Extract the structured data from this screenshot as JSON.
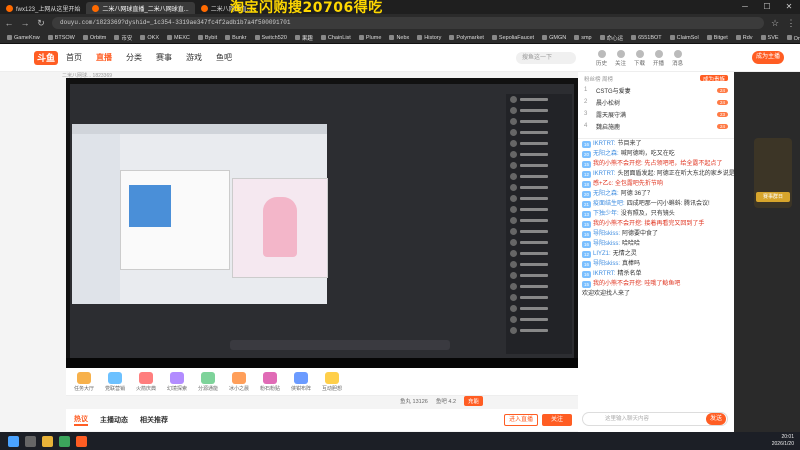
{
  "browser": {
    "tabs": [
      {
        "label": "fwx123_上网从这里开始",
        "active": false
      },
      {
        "label": "二米八网球直播_二米八网球直...",
        "active": true
      },
      {
        "label": "二米八网球直...",
        "active": false
      }
    ],
    "promo_banner": "淘宝闪购搜20706得吃",
    "url": "douyu.com/1823369?dyshid=_1c354-3319ae347fc4f2adb1b7a4f500091701",
    "bookmarks": [
      "GameKnw",
      "BTSOW",
      "Orbitm",
      "币安",
      "OKX",
      "MEXC",
      "Bybit",
      "Bunkr",
      "Switch520",
      "果趣",
      "ChainList",
      "Plume",
      "Nebx",
      "History",
      "Polymarket",
      "SepoliaFaucet",
      "GMGN",
      "smp",
      "命心运",
      "6551BOT",
      "ClaimSol",
      "Bitget",
      "Rdv",
      "SVE",
      "Onlve - 鑫鑫"
    ]
  },
  "site": {
    "logo": "斗鱼",
    "nav": [
      "首页",
      "直播",
      "分类",
      "赛事",
      "游戏",
      "鱼吧"
    ],
    "search_placeholder": "搜鱼这一下",
    "top_icons": [
      "历史",
      "关注",
      "下载",
      "开播",
      "消息"
    ],
    "login": "成为主播",
    "room_subtitle": "二米八网球...  1823369"
  },
  "player": {
    "gift_bar": [
      "任务大厅",
      "党联营销",
      "火箭庆典",
      "幻境探索",
      "分源通能",
      "冰小之晨",
      "粉石粉贴",
      "侠钳布阵",
      "互动胆想"
    ],
    "stats": {
      "fans_label": "鱼丸 13126",
      "rank": "鱼吧 4.2",
      "button": "充能"
    }
  },
  "bottom_tabs": [
    "热议",
    "主播动态",
    "相关推荐"
  ],
  "actions": {
    "enter": "进入直播",
    "follow": "关注"
  },
  "chat": {
    "header": "粉丝榜 周榜",
    "header_cta": "成为贵族",
    "ranking": [
      {
        "n": "1",
        "name": "CSTG与爱妻",
        "badge": "24"
      },
      {
        "n": "2",
        "name": "晨小松树",
        "badge": "24"
      },
      {
        "n": "3",
        "name": "露天展守满",
        "badge": "23"
      },
      {
        "n": "4",
        "name": "魏启施鹿",
        "badge": "24"
      }
    ],
    "messages": [
      {
        "lv": "16",
        "name": "IKRTRT:",
        "text": "节目来了",
        "red": false
      },
      {
        "lv": "20",
        "name": "无阳之森:",
        "text": "喊阿德哟，吃又在吃",
        "red": false
      },
      {
        "lv": "15",
        "name": "",
        "text": "我的小熊不会开挖: 先占领吧吧，给全露不起点了",
        "red": true
      },
      {
        "lv": "12",
        "name": "IKRTRT:",
        "text": "头团面盾发起: 阿德正在听大东北的家乡说是",
        "red": false
      },
      {
        "lv": "18",
        "name": "",
        "text": "感+乙c: 全包露吧先折节响",
        "red": true
      },
      {
        "lv": "20",
        "name": "无阳之森:",
        "text": "阿德 36了？",
        "red": false
      },
      {
        "lv": "21",
        "name": "疫面结生吧:",
        "text": "四成吧那一闪小蝌蚪: 腾讯会议!",
        "red": false
      },
      {
        "lv": "13",
        "name": "下独少年:",
        "text": "没有照及，只有镜头",
        "red": false
      },
      {
        "lv": "15",
        "name": "",
        "text": "我的小熊不会开挖: 接着再看完又回到了手",
        "red": true
      },
      {
        "lv": "16",
        "name": "导阳skiss:",
        "text": "阿德要中食了",
        "red": false
      },
      {
        "lv": "16",
        "name": "导阳skiss:",
        "text": "哈哈哈",
        "red": false
      },
      {
        "lv": "12",
        "name": "LIYZ1:",
        "text": "无情之灵",
        "red": false
      },
      {
        "lv": "16",
        "name": "导阳skiss:",
        "text": "真棒吗",
        "red": false
      },
      {
        "lv": "16",
        "name": "IKRTRT:",
        "text": "精杀名单",
        "red": false
      },
      {
        "lv": "15",
        "name": "",
        "text": "我的小熊不会开挖: 哇哦了鲶鱼吧",
        "red": true
      },
      {
        "lv": "",
        "name": "",
        "text": "欢迎欢迎找人来了",
        "red": false
      }
    ],
    "input_placeholder": "这里输入聊天内容",
    "send": "发送"
  },
  "sidebar": {
    "trophy_label": "赛事群日"
  },
  "taskbar": {
    "time": "20:01",
    "date": "2026/1/20"
  }
}
